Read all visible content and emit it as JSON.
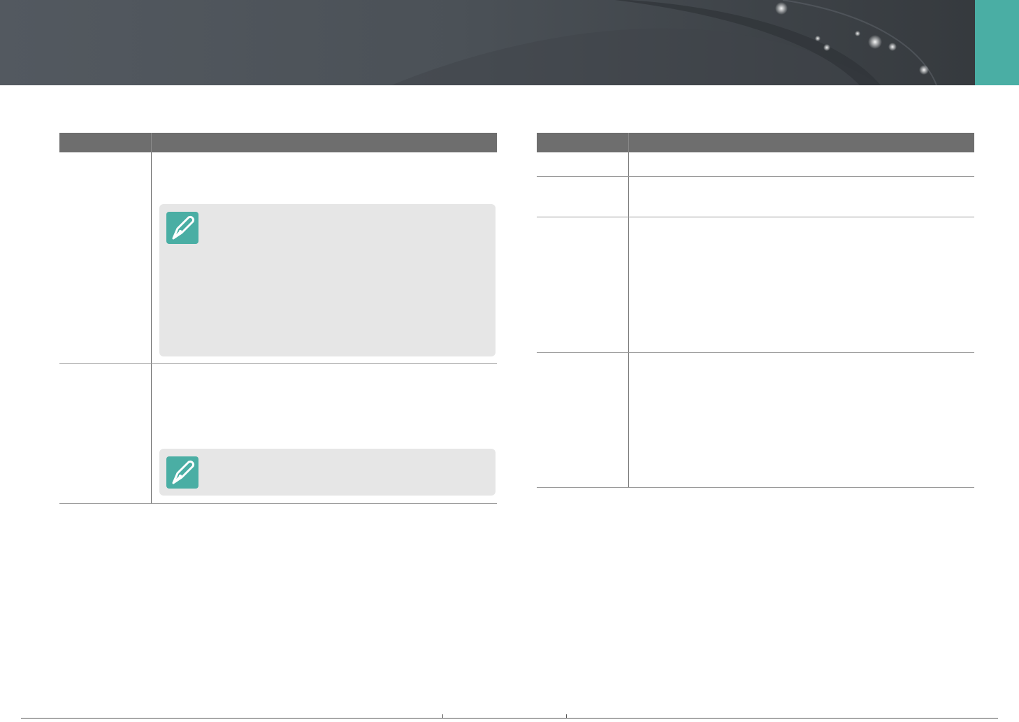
{
  "header": {
    "accent_color": "#4aaea4",
    "banner_color": "#4b5157"
  },
  "left_table": {
    "columns": [
      "",
      ""
    ],
    "rows": [
      {
        "name": "",
        "description": "",
        "has_note": true
      },
      {
        "name": "",
        "description": "",
        "has_note": true
      }
    ]
  },
  "right_table": {
    "columns": [
      "",
      ""
    ],
    "rows": [
      {
        "name": "",
        "description": ""
      },
      {
        "name": "",
        "description": ""
      },
      {
        "name": "",
        "description": ""
      },
      {
        "name": "",
        "description": ""
      }
    ]
  },
  "notes": {
    "icon": "pen-nib-icon"
  }
}
